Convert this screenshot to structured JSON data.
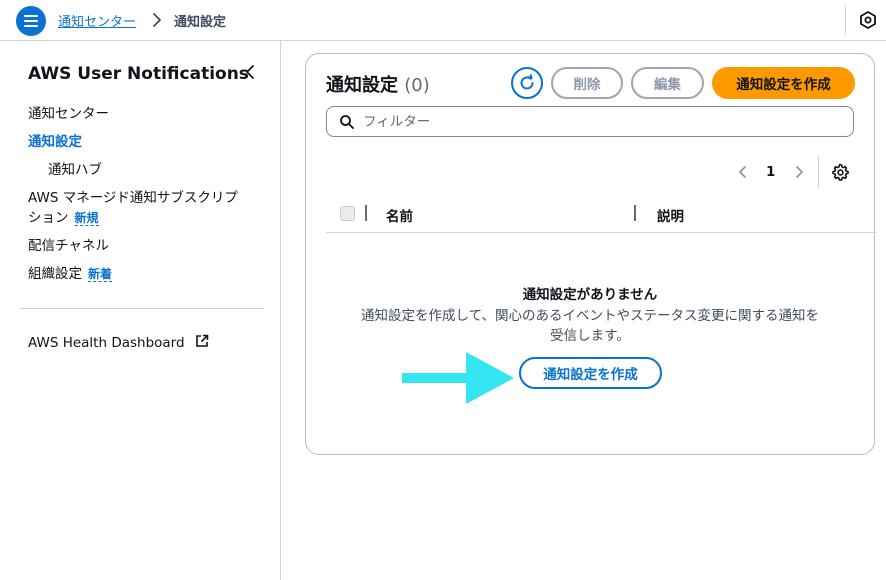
{
  "breadcrumb": {
    "parent": "通知センター",
    "current": "通知設定"
  },
  "icons": {
    "menu": "hamburger-menu-icon",
    "top_right": "hexagon-settings-icon",
    "refresh": "refresh-icon",
    "search": "search-icon",
    "settings": "gear-icon",
    "external": "external-link-icon"
  },
  "sidebar": {
    "title": "AWS User Notifications",
    "items": [
      {
        "label": "通知センター"
      },
      {
        "label": "通知設定"
      },
      {
        "label": "通知ハブ"
      },
      {
        "label_line1": "AWS マネージド通知サブスクリプ",
        "label_line2": "ション",
        "badge": "新規"
      },
      {
        "label": "配信チャネル"
      },
      {
        "label": "組織設定",
        "badge": "新着"
      }
    ],
    "footer_link": "AWS Health Dashboard"
  },
  "panel": {
    "title": "通知設定",
    "count": "(0)",
    "buttons": {
      "delete": "削除",
      "edit": "編集",
      "create": "通知設定を作成"
    },
    "filter": {
      "placeholder": "フィルター",
      "value": ""
    },
    "pagination": {
      "current_page": "1"
    },
    "table": {
      "columns": [
        "名前",
        "説明"
      ]
    },
    "empty_state": {
      "title": "通知設定がありません",
      "description": "通知設定を作成して、関心のあるイベントやステータス変更に関する通知を受信します。",
      "button": "通知設定を作成"
    }
  },
  "colors": {
    "link_blue": "#0972d3",
    "primary_orange": "#ff9900",
    "annotation_arrow": "#33e6f2"
  }
}
